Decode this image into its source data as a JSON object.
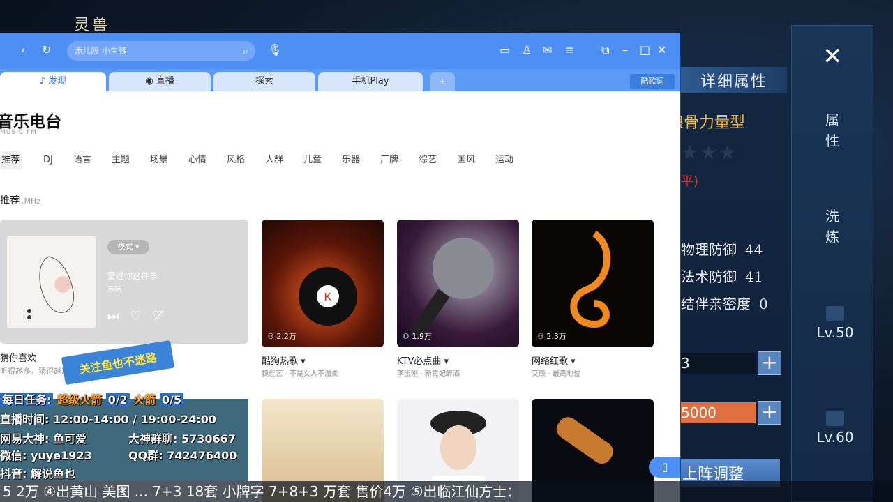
{
  "game": {
    "top_title": "灵兽",
    "panel_title": "详细属性",
    "type_label": "狼骨力量型",
    "type_visible": "狼骨力量型",
    "stars": "★★★",
    "rating": "平)",
    "stats": [
      {
        "label": "物理防御",
        "value": "44"
      },
      {
        "label": "法术防御",
        "value": "41"
      },
      {
        "label": "结伴亲密度",
        "value": "0"
      }
    ],
    "bar1_value": "3",
    "bar2_value": "5000",
    "adjust_label": "上阵调整",
    "nav": {
      "close_icon": "close-x-icon",
      "attr_label": "属性",
      "refine_label": "洗炼",
      "lv1": "Lv.50",
      "lv2": "Lv.60"
    },
    "ticker": "5  2万  ④出黄山  美图  ... 7+3  18套  小牌字  7+8+3  万套  售价4万  ⑤出临江仙方士："
  },
  "app": {
    "search_placeholder": "添儿殴 小生辣",
    "tabs": [
      {
        "label": "发现",
        "icon": "music-note-icon"
      },
      {
        "label": "直播",
        "icon": "live-dot-icon"
      },
      {
        "label": "探索"
      },
      {
        "label": "手机Play"
      }
    ],
    "add_tab": "+",
    "lyric_button": "酷歌词",
    "page_title": "音乐电台",
    "page_subtitle": "MUSIC FM",
    "categories": [
      "推荐",
      "DJ",
      "语言",
      "主题",
      "场景",
      "心情",
      "风格",
      "人群",
      "儿童",
      "乐器",
      "厂牌",
      "综艺",
      "国风",
      "运动"
    ],
    "section_title": "推荐",
    "section_unit": ".MHz",
    "feature": {
      "mode_label": "模式",
      "song": "爱过你这件事",
      "artist": "苏晗",
      "caption": "猜你喜欢",
      "desc": "听得越多，猜得越准"
    },
    "cards": [
      {
        "title": "酷狗热歌",
        "desc": "魏佳艺 - 不是女人不温柔",
        "count": "2.2万"
      },
      {
        "title": "KTV必点曲",
        "desc": "李玉刚 - 新贵妃醉酒",
        "count": "1.9万"
      },
      {
        "title": "网络红歌",
        "desc": "艾辰 - 最高地位",
        "count": "2.3万"
      }
    ]
  },
  "overlay": {
    "banner": "关注鱼也不迷路",
    "task_prefix": "每日任务:",
    "task_rocket": "超级火箭",
    "task_rocket_count": "0/2",
    "task_fire": "火箭",
    "task_fire_count": "0/5",
    "time": "直播时间: 12:00-14:00 / 19:00-24:00",
    "netease_god": "网易大神: 鱼可爱",
    "group": "大神群聊: 5730667",
    "wechat": "微信: yuye1923",
    "qq": "QQ群: 742476400",
    "douyin": "抖音: 解说鱼也"
  }
}
